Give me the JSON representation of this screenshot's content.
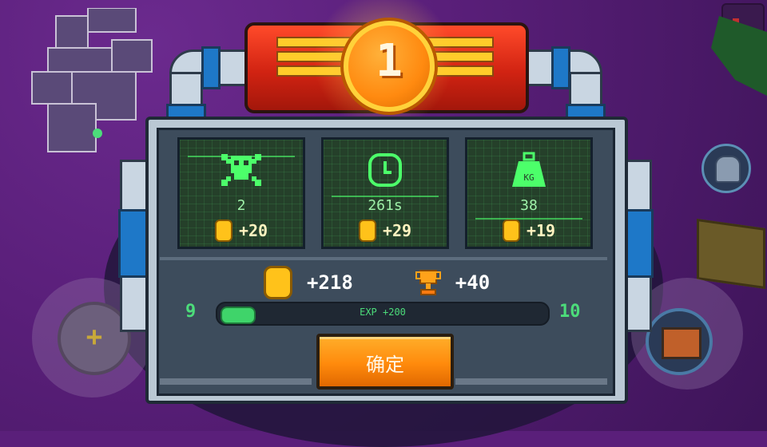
{
  "rank": "1",
  "stats": [
    {
      "icon": "skull-icon",
      "value": "2",
      "reward": "+20"
    },
    {
      "icon": "clock-icon",
      "value": "261s",
      "reward": "+29"
    },
    {
      "icon": "weight-icon",
      "value": "38",
      "reward": "+19",
      "icon_text": "KG"
    }
  ],
  "totals": {
    "coins": "+218",
    "trophies": "+40"
  },
  "exp": {
    "from_level": "9",
    "to_level": "10",
    "label": "EXP +200",
    "fill_fraction": 0.1
  },
  "confirm_label": "确定",
  "colors": {
    "accent_green": "#4cdc7a",
    "coin_gold": "#ffc21a",
    "banner_red": "#d12312",
    "button_orange": "#ff8a0c"
  }
}
